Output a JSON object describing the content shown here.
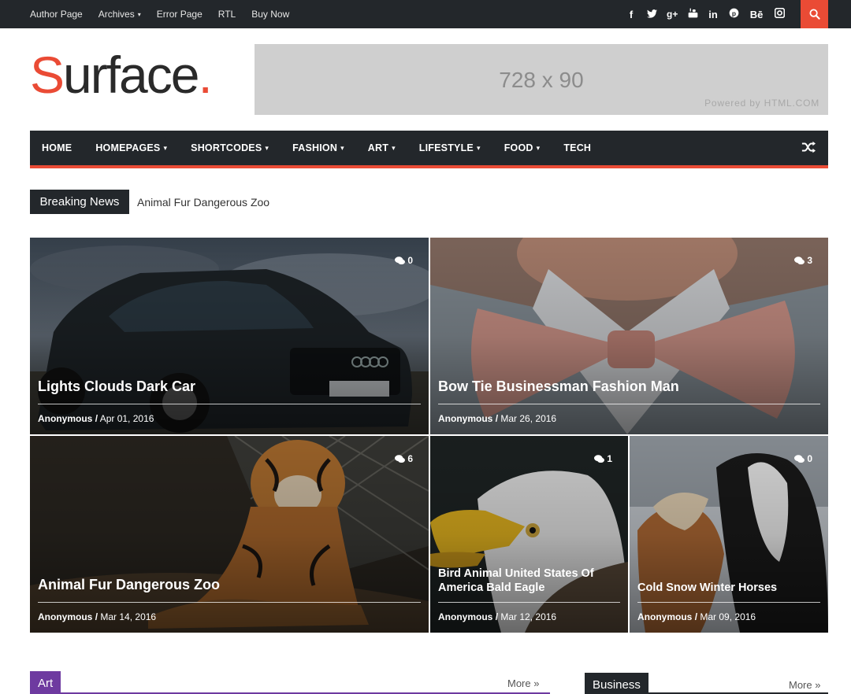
{
  "topbar": {
    "links": [
      "Author Page",
      "Archives",
      "Error Page",
      "RTL",
      "Buy Now"
    ],
    "archives_caret": "▾",
    "social_icons": [
      "facebook-icon",
      "twitter-icon",
      "google-plus-icon",
      "youtube-icon",
      "linkedin-icon",
      "pinterest-icon",
      "behance-icon",
      "instagram-icon"
    ]
  },
  "logo": {
    "first": "S",
    "rest": "urface",
    "dot": "."
  },
  "ad": {
    "size": "728 x 90",
    "powered": "Powered by HTML.COM"
  },
  "nav": {
    "items": [
      "HOME",
      "HOMEPAGES",
      "SHORTCODES",
      "FASHION",
      "ART",
      "LIFESTYLE",
      "FOOD",
      "TECH"
    ],
    "caret": "▾"
  },
  "breaking": {
    "label": "Breaking News",
    "text": "Animal Fur Dangerous Zoo"
  },
  "posts": [
    {
      "title": "Lights Clouds Dark Car",
      "author": "Anonymous",
      "sep": "/",
      "date": "Apr 01, 2016",
      "comments": "0"
    },
    {
      "title": "Bow Tie Businessman Fashion Man",
      "author": "Anonymous",
      "sep": "/",
      "date": "Mar 26, 2016",
      "comments": "3"
    },
    {
      "title": "Animal Fur Dangerous Zoo",
      "author": "Anonymous",
      "sep": "/",
      "date": "Mar 14, 2016",
      "comments": "6"
    },
    {
      "title": "Bird Animal United States Of America Bald Eagle",
      "author": "Anonymous",
      "sep": "/",
      "date": "Mar 12, 2016",
      "comments": "1"
    },
    {
      "title": "Cold Snow Winter Horses",
      "author": "Anonymous",
      "sep": "/",
      "date": "Mar 09, 2016",
      "comments": "0"
    }
  ],
  "sections": [
    {
      "label": "Art",
      "more": "More »",
      "color": "#6e3aa0"
    },
    {
      "label": "Business",
      "more": "More »",
      "color": "#23272b"
    }
  ],
  "colors": {
    "accent": "#ea4b35",
    "dark": "#23272b"
  }
}
